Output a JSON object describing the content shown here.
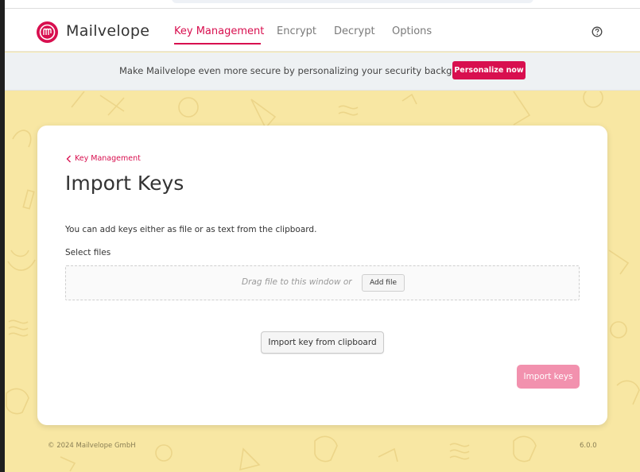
{
  "app": {
    "name": "Mailvelope"
  },
  "nav": {
    "items": [
      {
        "label": "Key Management",
        "active": true
      },
      {
        "label": "Encrypt",
        "active": false
      },
      {
        "label": "Decrypt",
        "active": false
      },
      {
        "label": "Options",
        "active": false
      }
    ],
    "help_icon": "question-circle"
  },
  "banner": {
    "text": "Make Mailvelope even more secure by personalizing your security background.",
    "button_label": "Personalize now"
  },
  "page": {
    "back_link": "Key Management",
    "title": "Import Keys",
    "description": "You can add keys either as file or as text from the clipboard.",
    "select_files_label": "Select files",
    "drop_text": "Drag file to this window or",
    "add_file_label": "Add file",
    "clipboard_label": "Import key from clipboard",
    "import_label": "Import keys"
  },
  "footer": {
    "copyright": "© 2024  Mailvelope GmbH",
    "version": "6.0.0"
  },
  "colors": {
    "accent": "#d80f4f",
    "background_pattern": "#f8e7a3",
    "disabled_button": "#f291ae"
  }
}
